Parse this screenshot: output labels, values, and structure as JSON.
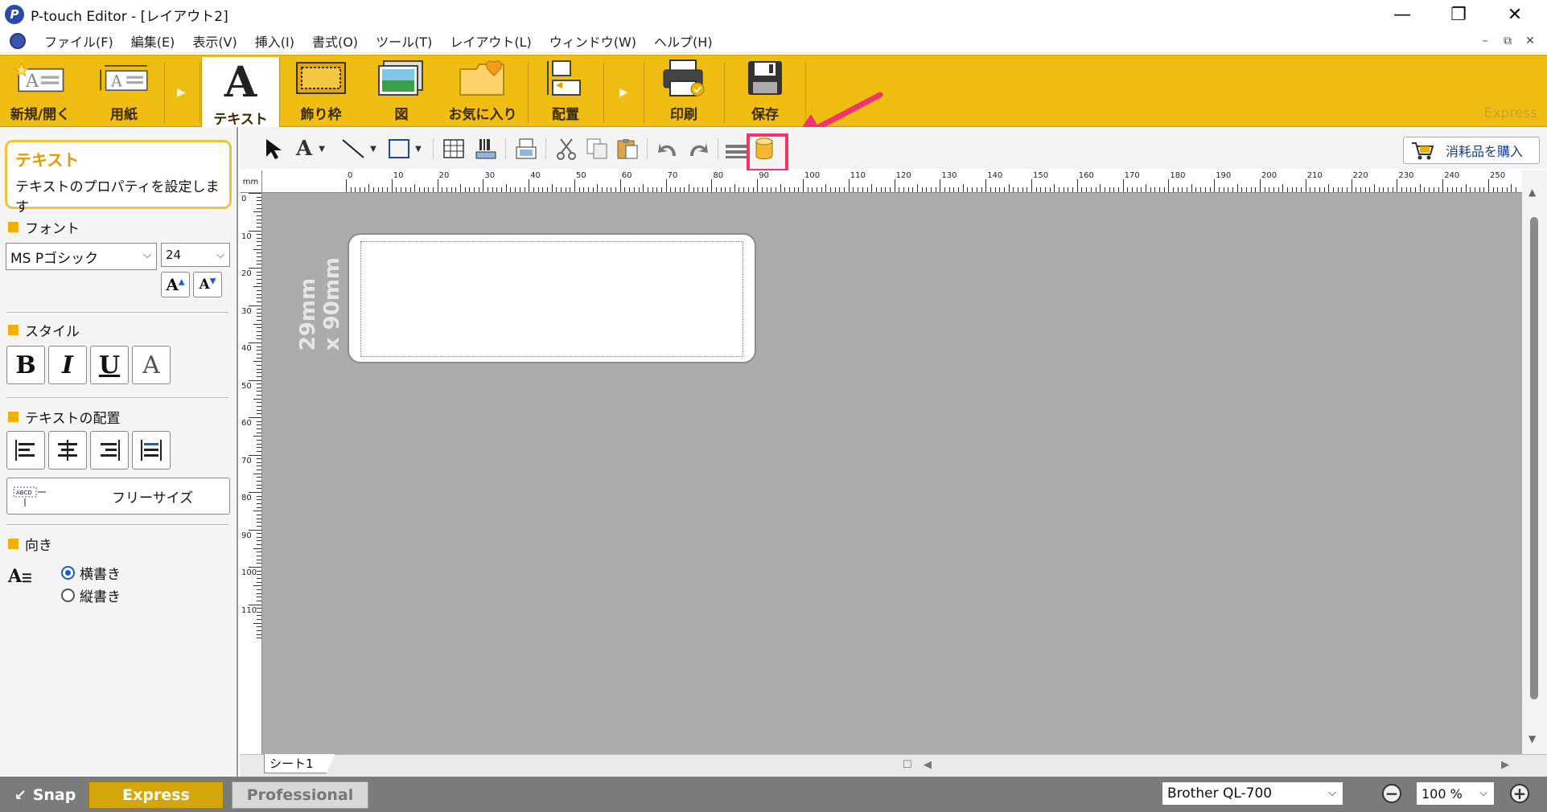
{
  "window": {
    "title": "P-touch Editor - [レイアウト2]",
    "minimize_glyph": "—",
    "restore_glyph": "❐",
    "close_glyph": "✕"
  },
  "menu": [
    "ファイル(F)",
    "編集(E)",
    "表示(V)",
    "挿入(I)",
    "書式(O)",
    "ツール(T)",
    "レイアウト(L)",
    "ウィンドウ(W)",
    "ヘルプ(H)"
  ],
  "mdi_controls": [
    "–",
    "⧉",
    "✕"
  ],
  "ribbon": {
    "groups": [
      {
        "label": "新規/開く",
        "icon": "new-open-icon"
      },
      {
        "label": "用紙",
        "icon": "paper-icon"
      },
      {
        "label": "テキスト",
        "icon": "text-icon",
        "active": true
      },
      {
        "label": "飾り枠",
        "icon": "frame-icon"
      },
      {
        "label": "図",
        "icon": "image-icon"
      },
      {
        "label": "お気に入り",
        "icon": "favorites-icon"
      },
      {
        "label": "配置",
        "icon": "arrange-icon"
      },
      {
        "label": "印刷",
        "icon": "print-icon"
      },
      {
        "label": "保存",
        "icon": "save-icon"
      }
    ],
    "mode_label": "Express",
    "accent_color": "#f0bd12"
  },
  "panel": {
    "title": "テキスト",
    "description": "テキストのプロパティを設定します",
    "font_section": "フォント",
    "font_name": "MS Pゴシック",
    "font_size": "24",
    "style_section": "スタイル",
    "style_buttons": [
      "B",
      "I",
      "U",
      "A"
    ],
    "align_section": "テキストの配置",
    "free_size_label": "フリーサイズ",
    "orientation_section": "向き",
    "orientation_options": [
      {
        "label": "横書き",
        "selected": true
      },
      {
        "label": "縦書き",
        "selected": false
      }
    ]
  },
  "toolbar": {
    "buy_label": "消耗品を購入",
    "highlight_color": "#f0356e"
  },
  "ruler": {
    "unit": "mm",
    "top_ticks": [
      "0",
      "10",
      "20",
      "30",
      "40",
      "50",
      "60",
      "70",
      "80",
      "90",
      "100",
      "110",
      "120",
      "130",
      "140",
      "150",
      "160",
      "170",
      "180",
      "190",
      "200",
      "210",
      "220",
      "230",
      "240",
      "250"
    ],
    "left_ticks": [
      "0",
      "10",
      "20",
      "30",
      "40",
      "50",
      "60",
      "70",
      "80",
      "90",
      "100",
      "110"
    ]
  },
  "canvas": {
    "size_line1": "29mm",
    "size_line2": "x 90mm",
    "sheet_tab": "シート1"
  },
  "statusbar": {
    "snap_label": "Snap",
    "express_label": "Express",
    "professional_label": "Professional",
    "printer": "Brother QL-700",
    "zoom": "100 %"
  }
}
